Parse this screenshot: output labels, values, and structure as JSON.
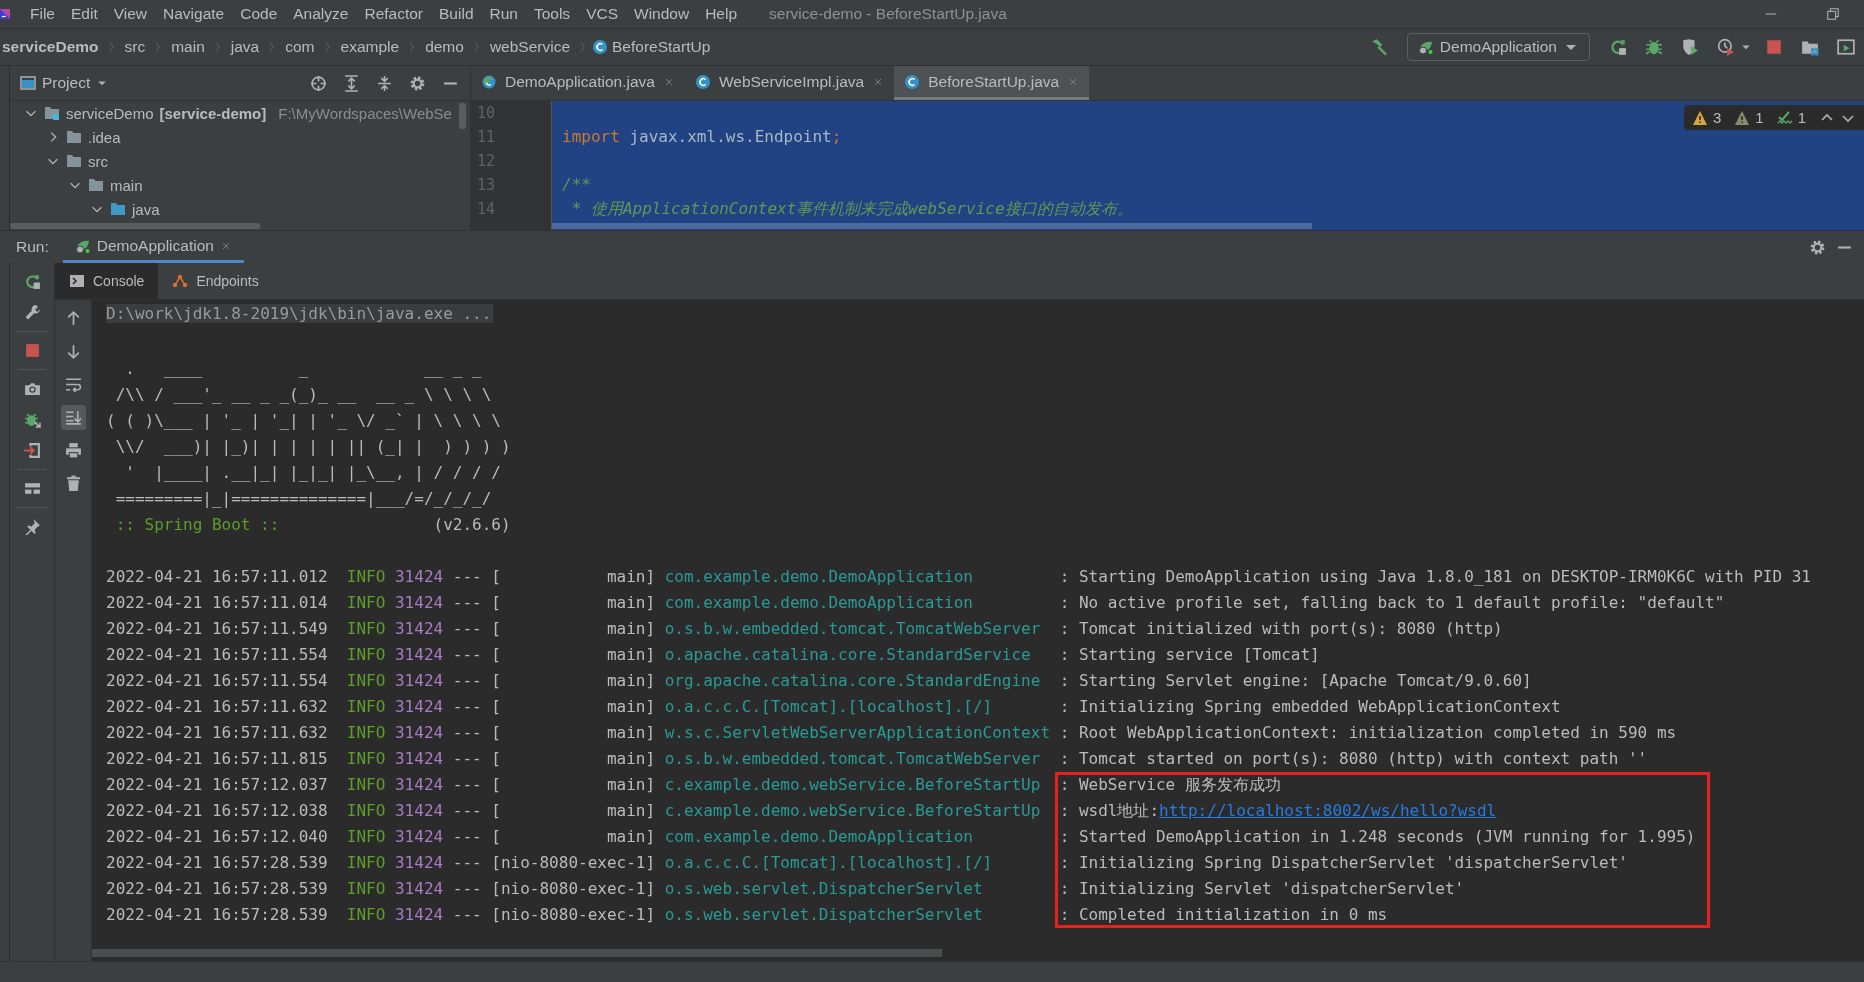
{
  "menu": [
    "File",
    "Edit",
    "View",
    "Navigate",
    "Code",
    "Analyze",
    "Refactor",
    "Build",
    "Run",
    "Tools",
    "VCS",
    "Window",
    "Help"
  ],
  "window_title": "service-demo - BeforeStartUp.java",
  "breadcrumb": [
    {
      "label": "serviceDemo",
      "kind": "project"
    },
    {
      "label": "src",
      "kind": "folder"
    },
    {
      "label": "main",
      "kind": "folder"
    },
    {
      "label": "java",
      "kind": "folder"
    },
    {
      "label": "com",
      "kind": "folder"
    },
    {
      "label": "example",
      "kind": "folder"
    },
    {
      "label": "demo",
      "kind": "folder"
    },
    {
      "label": "webService",
      "kind": "folder"
    },
    {
      "label": "BeforeStartUp",
      "kind": "class"
    }
  ],
  "run_config": "DemoApplication",
  "project_panel": {
    "title": "Project",
    "tree": [
      {
        "label": "serviceDemo",
        "module": "[service-demo]",
        "path": "F:\\MyWordspaces\\WebSe",
        "kind": "module",
        "expanded": true,
        "children": [
          {
            "label": ".idea",
            "kind": "folder",
            "expanded": false
          },
          {
            "label": "src",
            "kind": "folder",
            "expanded": true,
            "children": [
              {
                "label": "main",
                "kind": "folder",
                "expanded": true,
                "children": [
                  {
                    "label": "java",
                    "kind": "source",
                    "expanded": true
                  }
                ]
              }
            ]
          }
        ]
      }
    ]
  },
  "editor": {
    "tabs": [
      {
        "label": "DemoApplication.java",
        "kind": "app",
        "selected": false
      },
      {
        "label": "WebServiceImpl.java",
        "kind": "class",
        "selected": false
      },
      {
        "label": "BeforeStartUp.java",
        "kind": "class",
        "selected": true
      }
    ],
    "lines": [
      {
        "number": "10"
      },
      {
        "number": "11",
        "tokens": [
          {
            "text": "import",
            "kind": "keyword"
          },
          {
            "text": " javax.xml.ws.Endpoint",
            "kind": "plain"
          },
          {
            "text": ";",
            "kind": "keyword"
          }
        ]
      },
      {
        "number": "12"
      },
      {
        "number": "13",
        "tokens": [
          {
            "text": "/**",
            "kind": "doc"
          }
        ]
      },
      {
        "number": "14",
        "tokens": [
          {
            "text": " * 使用ApplicationContext事件机制来完成webService接口的自动发布。",
            "kind": "doc"
          }
        ]
      }
    ],
    "inspections": [
      {
        "kind": "warning",
        "count": "3"
      },
      {
        "kind": "weak",
        "count": "1"
      },
      {
        "kind": "typo",
        "count": "1"
      }
    ]
  },
  "run": {
    "label": "Run:",
    "tabs": [
      {
        "label": "DemoApplication",
        "selected": true
      }
    ],
    "subtabs": [
      {
        "label": "Console",
        "kind": "console",
        "selected": true
      },
      {
        "label": "Endpoints",
        "kind": "endpoints",
        "selected": false
      }
    ],
    "console_tools": [
      {
        "kind": "up",
        "on": false
      },
      {
        "kind": "down",
        "on": false
      },
      {
        "kind": "wrap",
        "on": false
      },
      {
        "kind": "scroll-end",
        "on": true
      },
      {
        "kind": "print",
        "on": false
      },
      {
        "kind": "trash",
        "on": false
      }
    ]
  },
  "console": {
    "command": "D:\\work\\jdk1.8-2019\\jdk\\bin\\java.exe ...",
    "banner": [
      "  .   ____          _            __ _ _",
      " /\\\\ / ___'_ __ _ _(_)_ __  __ _ \\ \\ \\ \\",
      "( ( )\\___ | '_ | '_| | '_ \\/ _` | \\ \\ \\ \\",
      " \\\\/  ___)| |_)| | | | | || (_| |  ) ) ) )",
      "  '  |____| .__|_| |_|_| |_\\__, | / / / /",
      " =========|_|==============|___/=/_/_/_/"
    ],
    "spring_label": ":: Spring Boot ::",
    "spring_version": "(v2.6.6)",
    "logs": [
      {
        "time": "2022-04-21 16:57:11.012",
        "level": "INFO",
        "pid": "31424",
        "sep": "---",
        "thread": "[           main]",
        "logger": "com.example.demo.DemoApplication",
        "message": ": Starting DemoApplication using Java 1.8.0_181 on DESKTOP-IRM0K6C with PID 31",
        "highlighted": false
      },
      {
        "time": "2022-04-21 16:57:11.014",
        "level": "INFO",
        "pid": "31424",
        "sep": "---",
        "thread": "[           main]",
        "logger": "com.example.demo.DemoApplication",
        "message": ": No active profile set, falling back to 1 default profile: \"default\"",
        "highlighted": false
      },
      {
        "time": "2022-04-21 16:57:11.549",
        "level": "INFO",
        "pid": "31424",
        "sep": "---",
        "thread": "[           main]",
        "logger": "o.s.b.w.embedded.tomcat.TomcatWebServer",
        "message": ": Tomcat initialized with port(s): 8080 (http)",
        "highlighted": false
      },
      {
        "time": "2022-04-21 16:57:11.554",
        "level": "INFO",
        "pid": "31424",
        "sep": "---",
        "thread": "[           main]",
        "logger": "o.apache.catalina.core.StandardService",
        "message": ": Starting service [Tomcat]",
        "highlighted": false
      },
      {
        "time": "2022-04-21 16:57:11.554",
        "level": "INFO",
        "pid": "31424",
        "sep": "---",
        "thread": "[           main]",
        "logger": "org.apache.catalina.core.StandardEngine",
        "message": ": Starting Servlet engine: [Apache Tomcat/9.0.60]",
        "highlighted": false
      },
      {
        "time": "2022-04-21 16:57:11.632",
        "level": "INFO",
        "pid": "31424",
        "sep": "---",
        "thread": "[           main]",
        "logger": "o.a.c.c.C.[Tomcat].[localhost].[/]",
        "message": ": Initializing Spring embedded WebApplicationContext",
        "highlighted": false
      },
      {
        "time": "2022-04-21 16:57:11.632",
        "level": "INFO",
        "pid": "31424",
        "sep": "---",
        "thread": "[           main]",
        "logger": "w.s.c.ServletWebServerApplicationContext",
        "message": ": Root WebApplicationContext: initialization completed in 590 ms",
        "highlighted": false
      },
      {
        "time": "2022-04-21 16:57:11.815",
        "level": "INFO",
        "pid": "31424",
        "sep": "---",
        "thread": "[           main]",
        "logger": "o.s.b.w.embedded.tomcat.TomcatWebServer",
        "message": ": Tomcat started on port(s): 8080 (http) with context path ''",
        "highlighted": false
      },
      {
        "time": "2022-04-21 16:57:12.037",
        "level": "INFO",
        "pid": "31424",
        "sep": "---",
        "thread": "[           main]",
        "logger": "c.example.demo.webService.BeforeStartUp",
        "message": ": WebService 服务发布成功",
        "highlighted": true
      },
      {
        "time": "2022-04-21 16:57:12.038",
        "level": "INFO",
        "pid": "31424",
        "sep": "---",
        "thread": "[           main]",
        "logger": "c.example.demo.webService.BeforeStartUp",
        "message": ": wsdl地址:",
        "link": "http://localhost:8002/ws/hello?wsdl",
        "highlighted": true
      },
      {
        "time": "2022-04-21 16:57:12.040",
        "level": "INFO",
        "pid": "31424",
        "sep": "---",
        "thread": "[           main]",
        "logger": "com.example.demo.DemoApplication",
        "message": ": Started DemoApplication in 1.248 seconds (JVM running for 1.995)",
        "highlighted": true
      },
      {
        "time": "2022-04-21 16:57:28.539",
        "level": "INFO",
        "pid": "31424",
        "sep": "---",
        "thread": "[nio-8080-exec-1]",
        "logger": "o.a.c.c.C.[Tomcat].[localhost].[/]",
        "message": ": Initializing Spring DispatcherServlet 'dispatcherServlet'",
        "highlighted": true
      },
      {
        "time": "2022-04-21 16:57:28.539",
        "level": "INFO",
        "pid": "31424",
        "sep": "---",
        "thread": "[nio-8080-exec-1]",
        "logger": "o.s.web.servlet.DispatcherServlet",
        "message": ": Initializing Servlet 'dispatcherServlet'",
        "highlighted": true
      },
      {
        "time": "2022-04-21 16:57:28.539",
        "level": "INFO",
        "pid": "31424",
        "sep": "---",
        "thread": "[nio-8080-exec-1]",
        "logger": "o.s.web.servlet.DispatcherServlet",
        "message": ": Completed initialization in 0 ms",
        "highlighted": true
      }
    ]
  }
}
